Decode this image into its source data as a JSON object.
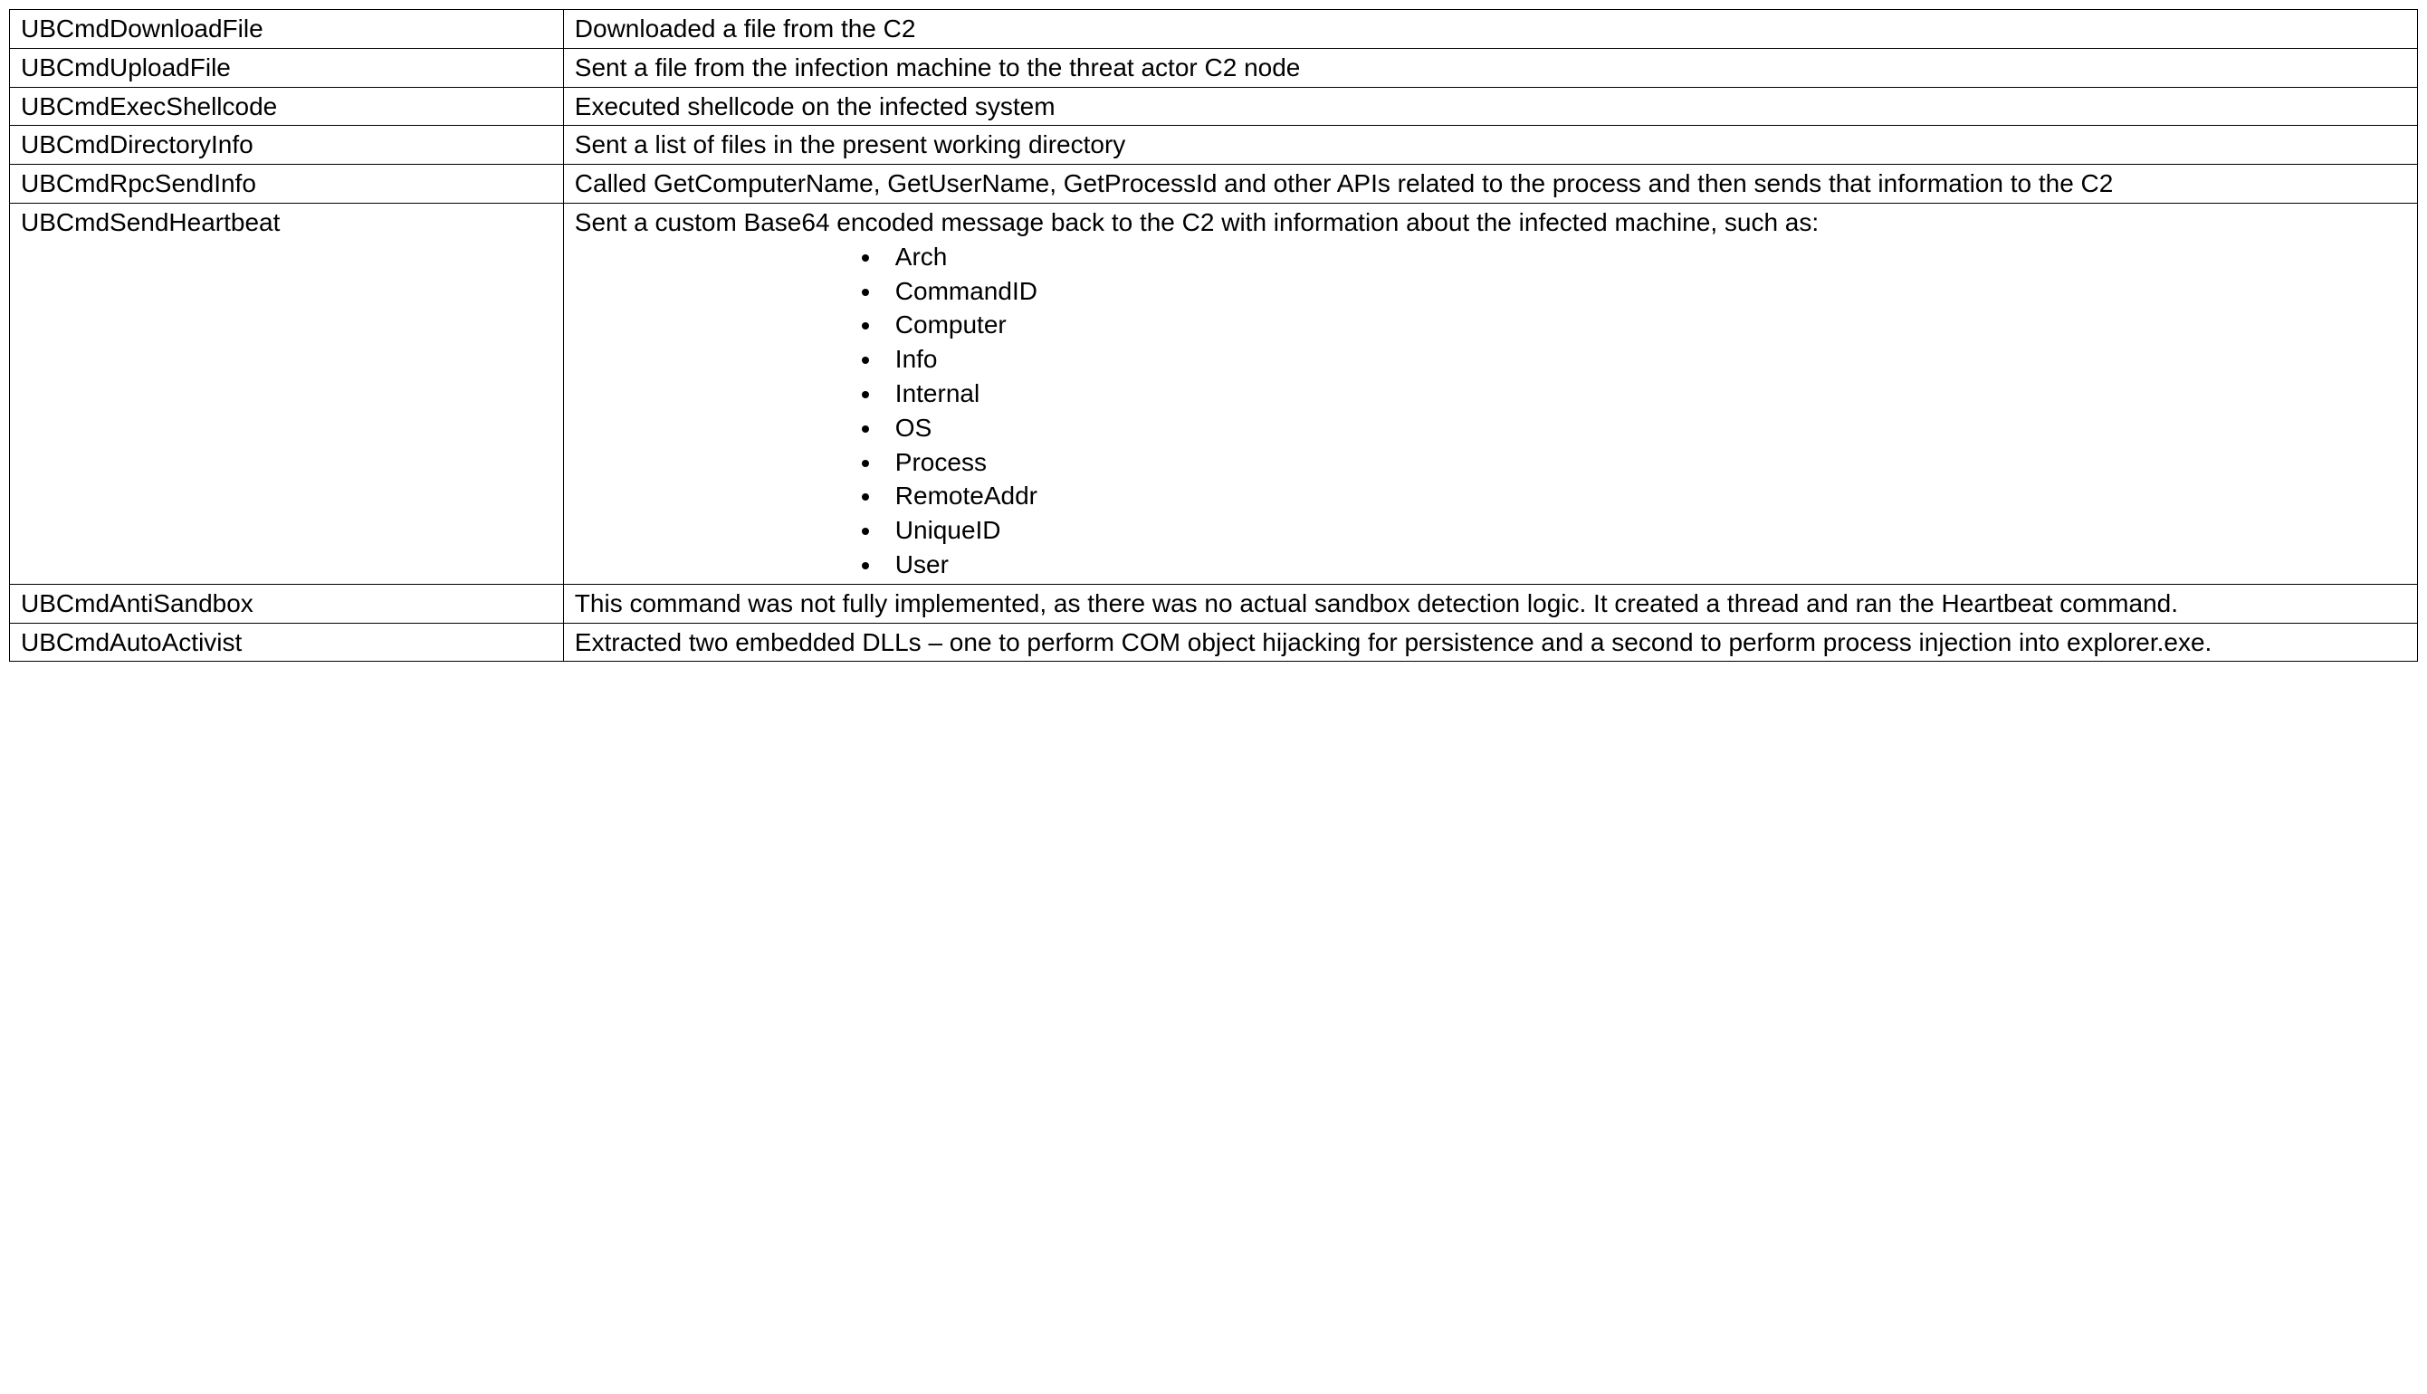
{
  "rows": [
    {
      "name": "UBCmdDownloadFile",
      "desc": "Downloaded a file from the C2"
    },
    {
      "name": "UBCmdUploadFile",
      "desc": "Sent a file from the infection machine to the threat actor C2 node"
    },
    {
      "name": "UBCmdExecShellcode",
      "desc": "Executed shellcode on the infected system"
    },
    {
      "name": "UBCmdDirectoryInfo",
      "desc": "Sent a list of files in the present working directory"
    },
    {
      "name": "UBCmdRpcSendInfo",
      "desc": "Called GetComputerName, GetUserName, GetProcessId and other APIs related to the process and then sends that information to the C2"
    },
    {
      "name": "UBCmdSendHeartbeat",
      "desc_intro": "Sent a custom Base64 encoded message back to the C2 with information about the infected machine, such as:",
      "bullets": [
        "Arch",
        "CommandID",
        "Computer",
        "Info",
        "Internal",
        "OS",
        "Process",
        "RemoteAddr",
        "UniqueID",
        "User"
      ]
    },
    {
      "name": "UBCmdAntiSandbox",
      "desc": "This command was not fully implemented, as there was no actual sandbox detection logic. It created a thread and ran the Heartbeat command."
    },
    {
      "name": "UBCmdAutoActivist",
      "desc": "Extracted two embedded DLLs – one to perform COM object hijacking for persistence and a second to perform process injection into explorer.exe."
    }
  ]
}
